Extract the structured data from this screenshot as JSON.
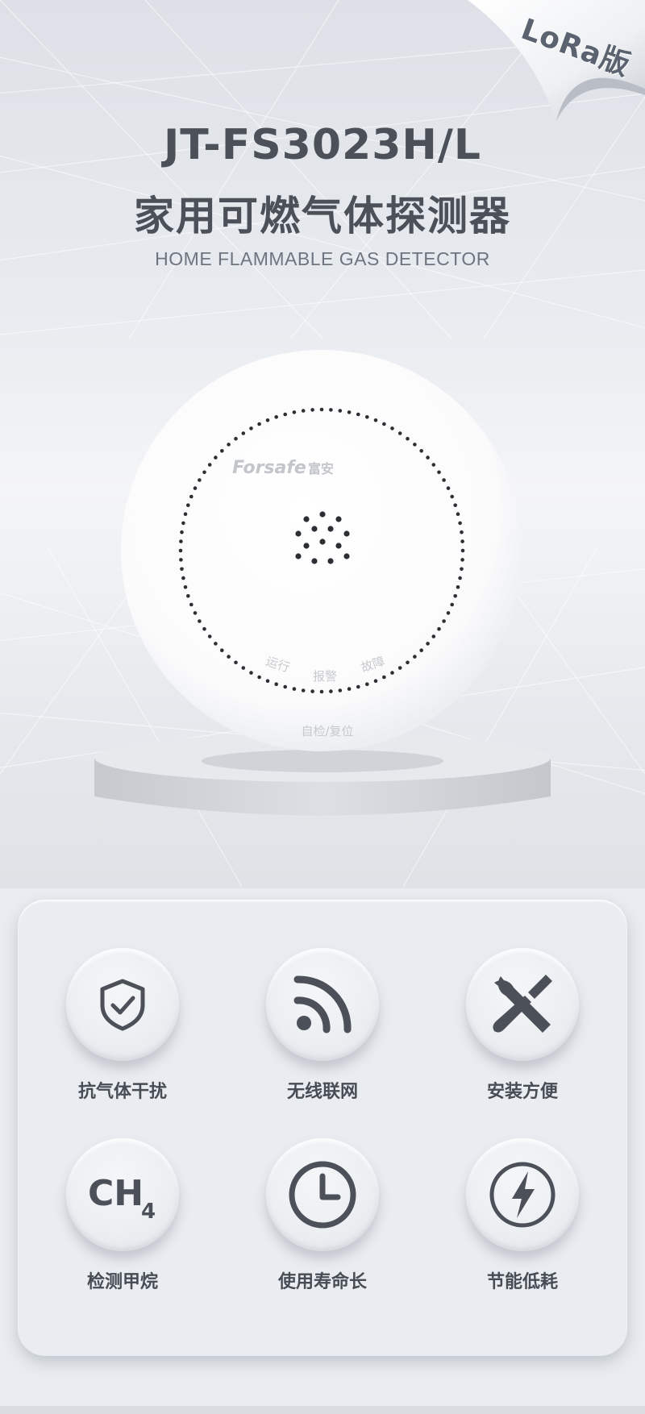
{
  "hero": {
    "corner_tag": "LoRa版",
    "model": "JT-FS3023H/L",
    "title_cn": "家用可燃气体探测器",
    "title_en": "HOME FLAMMABLE GAS DETECTOR"
  },
  "device": {
    "brand": "Forsafe",
    "brand_cn": "富安",
    "indicator_run": "运行",
    "indicator_alarm": "报警",
    "indicator_fault": "故障",
    "button_label": "自检/复位"
  },
  "features": [
    {
      "label": "抗气体干扰",
      "icon": "shield-check-icon"
    },
    {
      "label": "无线联网",
      "icon": "wireless-signal-icon"
    },
    {
      "label": "安装方便",
      "icon": "tools-icon"
    },
    {
      "label": "检测甲烷",
      "icon": "ch4-icon",
      "icon_text": "CH",
      "icon_sub": "4"
    },
    {
      "label": "使用寿命长",
      "icon": "clock-icon"
    },
    {
      "label": "节能低耗",
      "icon": "lightning-icon"
    }
  ],
  "colors": {
    "text_dark": "#484c54",
    "icon": "#4b5059",
    "panel_bg": "#e9ecf0"
  }
}
